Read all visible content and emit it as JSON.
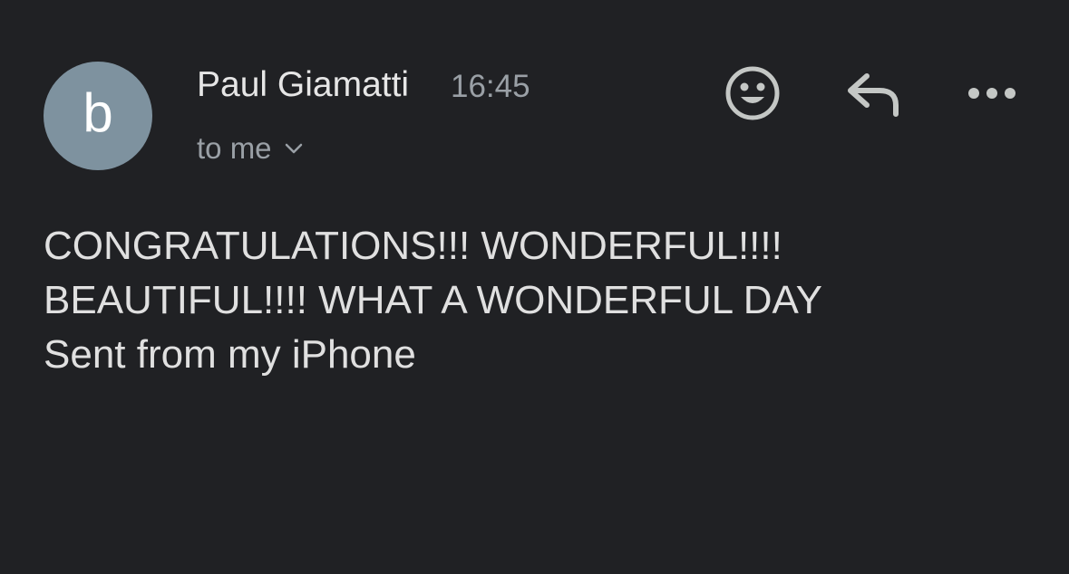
{
  "message": {
    "avatar_letter": "b",
    "sender": "Paul Giamatti",
    "time": "16:45",
    "recipient": "to me",
    "body_lines": [
      "CONGRATULATIONS!!! WONDERFUL!!!!",
      "BEAUTIFUL!!!! WHAT A WONDERFUL DAY",
      "Sent from my iPhone"
    ]
  },
  "actions": {
    "emoji_icon": "smiley-icon",
    "reply_icon": "reply-arrow-icon",
    "more_icon": "more-horizontal-icon"
  },
  "colors": {
    "background": "#202124",
    "avatar": "#7e929f",
    "secondary_text": "#9aa0a6",
    "primary_text": "#e3e3e3"
  }
}
